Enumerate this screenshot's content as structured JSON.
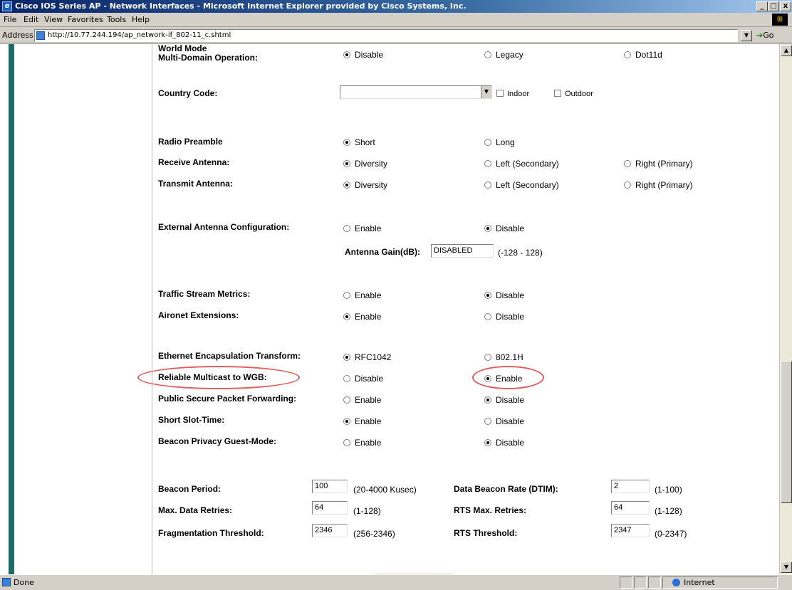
{
  "window": {
    "title": "Cisco IOS Series AP - Network Interfaces - Microsoft Internet Explorer provided by Cisco Systems, Inc.",
    "controls": {
      "minimize": "_",
      "maximize": "□",
      "close": "x"
    }
  },
  "menu": [
    "File",
    "Edit",
    "View",
    "Favorites",
    "Tools",
    "Help"
  ],
  "address": {
    "label": "Address",
    "url": "http://10.77.244.194/ap_network-if_802-11_c.shtml",
    "go_label": "Go"
  },
  "form": {
    "world_mode": {
      "label_line1": "World Mode",
      "label_line2": "Multi-Domain Operation:",
      "options": [
        "Disable",
        "Legacy",
        "Dot11d"
      ],
      "selected": "Disable"
    },
    "country_code": {
      "label": "Country Code:",
      "value": "",
      "indoor_label": "Indoor",
      "outdoor_label": "Outdoor"
    },
    "radio_preamble": {
      "label": "Radio Preamble",
      "options": [
        "Short",
        "Long"
      ],
      "selected": "Short"
    },
    "receive_antenna": {
      "label": "Receive Antenna:",
      "options": [
        "Diversity",
        "Left (Secondary)",
        "Right (Primary)"
      ],
      "selected": "Diversity"
    },
    "transmit_antenna": {
      "label": "Transmit Antenna:",
      "options": [
        "Diversity",
        "Left (Secondary)",
        "Right (Primary)"
      ],
      "selected": "Diversity"
    },
    "external_antenna": {
      "label": "External Antenna Configuration:",
      "options": [
        "Enable",
        "Disable"
      ],
      "selected": "Disable"
    },
    "antenna_gain": {
      "label": "Antenna Gain(dB):",
      "value": "DISABLED",
      "range": "(-128 - 128)"
    },
    "traffic_stream": {
      "label": "Traffic Stream Metrics:",
      "options": [
        "Enable",
        "Disable"
      ],
      "selected": "Disable"
    },
    "aironet_ext": {
      "label": "Aironet Extensions:",
      "options": [
        "Enable",
        "Disable"
      ],
      "selected": "Enable"
    },
    "ethernet_encap": {
      "label": "Ethernet Encapsulation Transform:",
      "options": [
        "RFC1042",
        "802.1H"
      ],
      "selected": "RFC1042"
    },
    "reliable_multicast": {
      "label": "Reliable Multicast to WGB:",
      "options": [
        "Disable",
        "Enable"
      ],
      "selected": "Enable"
    },
    "pspf": {
      "label": "Public Secure Packet Forwarding:",
      "options": [
        "Enable",
        "Disable"
      ],
      "selected": "Disable"
    },
    "short_slot": {
      "label": "Short Slot-Time:",
      "options": [
        "Enable",
        "Disable"
      ],
      "selected": "Enable"
    },
    "beacon_privacy": {
      "label": "Beacon Privacy Guest-Mode:",
      "options": [
        "Enable",
        "Disable"
      ],
      "selected": "Disable"
    },
    "beacon_period": {
      "label": "Beacon Period:",
      "value": "100",
      "range": "(20-4000 Kusec)"
    },
    "dtim": {
      "label": "Data Beacon Rate (DTIM):",
      "value": "2",
      "range": "(1-100)"
    },
    "max_retries": {
      "label": "Max. Data Retries:",
      "value": "64",
      "range": "(1-128)"
    },
    "rts_retries": {
      "label": "RTS Max. Retries:",
      "value": "64",
      "range": "(1-128)"
    },
    "frag_threshold": {
      "label": "Fragmentation Threshold:",
      "value": "2346",
      "range": "(256-2346)"
    },
    "rts_threshold": {
      "label": "RTS Threshold:",
      "value": "2347",
      "range": "(0-2347)"
    }
  },
  "status": {
    "text": "Done",
    "zone": "Internet"
  },
  "colors": {
    "titlebar": "#0a246a",
    "left_bar": "#1f6b68",
    "highlight": "#e15b5b"
  }
}
